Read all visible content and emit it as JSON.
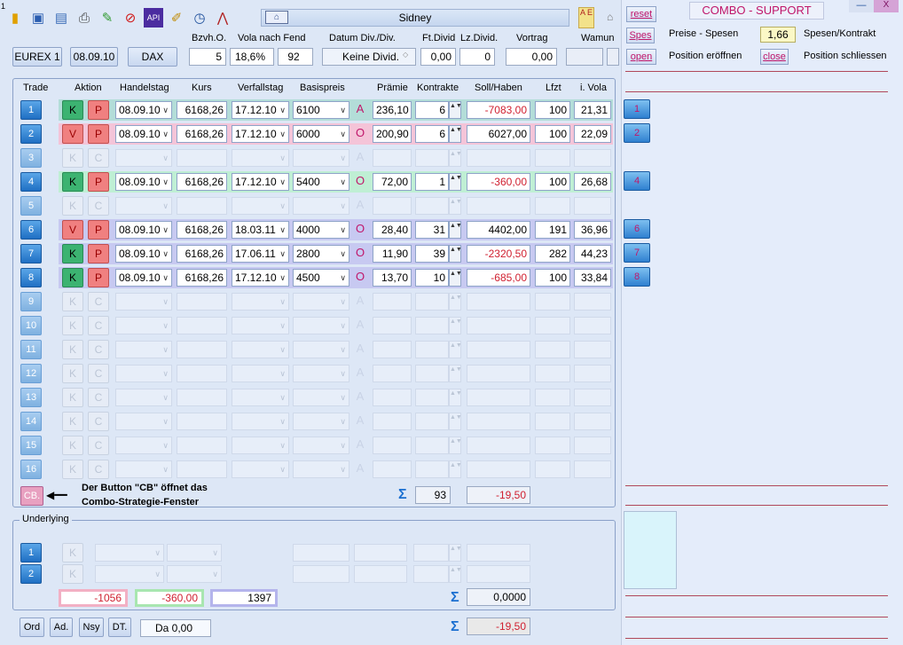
{
  "top_marker": "1",
  "toolbar": {
    "icons": [
      "notebook-icon",
      "save-icon",
      "document-icon",
      "printer-icon",
      "pencil-icon",
      "stop-icon",
      "api-icon",
      "edit-icon",
      "clock-icon",
      "chart-icon"
    ],
    "api_label": "API",
    "server": "Sidney",
    "ae_label": "A E"
  },
  "header_row": {
    "bzvh": "Bzvh.O.",
    "vola": "Vola nach Fend",
    "datum": "Datum Div./Div.",
    "ftdivid": "Ft.Divid",
    "lzdivid": "Lz.Divid.",
    "vortrag": "Vortrag",
    "wamun": "Wamun"
  },
  "market": {
    "exchange": "EUREX 1",
    "date": "08.09.10",
    "index": "DAX",
    "bzvh": "5",
    "vola": "18,6%",
    "vola_days": "92",
    "dividend": "Keine Divid.",
    "ftdivid": "0,00",
    "lzdivid": "0",
    "vortrag": "0,00"
  },
  "columns": {
    "trade": "Trade",
    "aktion": "Aktion",
    "handelstag": "Handelstag",
    "kurs": "Kurs",
    "verfallstag": "Verfallstag",
    "basispreis": "Basispreis",
    "praemie": "Prämie",
    "kontrakte": "Kontrakte",
    "sollhaben": "Soll/Haben",
    "lfzt": "Lfzt",
    "ivola": "i. Vola"
  },
  "rows": [
    {
      "n": "1",
      "a": "K",
      "b": "P",
      "handelstag": "08.09.10",
      "kurs": "6168,26",
      "verfall": "17.12.10",
      "basis": "6100",
      "ao": "A",
      "praemie": "236,10",
      "kontrakte": "6",
      "soll": "-7083,00",
      "lfzt": "100",
      "ivola": "21,31"
    },
    {
      "n": "2",
      "a": "V",
      "b": "P",
      "handelstag": "08.09.10",
      "kurs": "6168,26",
      "verfall": "17.12.10",
      "basis": "6000",
      "ao": "O",
      "praemie": "200,90",
      "kontrakte": "6",
      "soll": "6027,00",
      "lfzt": "100",
      "ivola": "22,09"
    },
    {
      "n": "3",
      "a": "K",
      "b": "C"
    },
    {
      "n": "4",
      "a": "K",
      "b": "P",
      "handelstag": "08.09.10",
      "kurs": "6168,26",
      "verfall": "17.12.10",
      "basis": "5400",
      "ao": "O",
      "praemie": "72,00",
      "kontrakte": "1",
      "soll": "-360,00",
      "lfzt": "100",
      "ivola": "26,68"
    },
    {
      "n": "5",
      "a": "K",
      "b": "C"
    },
    {
      "n": "6",
      "a": "V",
      "b": "P",
      "handelstag": "08.09.10",
      "kurs": "6168,26",
      "verfall": "18.03.11",
      "basis": "4000",
      "ao": "O",
      "praemie": "28,40",
      "kontrakte": "31",
      "soll": "4402,00",
      "lfzt": "191",
      "ivola": "36,96"
    },
    {
      "n": "7",
      "a": "K",
      "b": "P",
      "handelstag": "08.09.10",
      "kurs": "6168,26",
      "verfall": "17.06.11",
      "basis": "2800",
      "ao": "O",
      "praemie": "11,90",
      "kontrakte": "39",
      "soll": "-2320,50",
      "lfzt": "282",
      "ivola": "44,23"
    },
    {
      "n": "8",
      "a": "K",
      "b": "P",
      "handelstag": "08.09.10",
      "kurs": "6168,26",
      "verfall": "17.12.10",
      "basis": "4500",
      "ao": "O",
      "praemie": "13,70",
      "kontrakte": "10",
      "soll": "-685,00",
      "lfzt": "100",
      "ivola": "33,84"
    },
    {
      "n": "9",
      "a": "K",
      "b": "C"
    },
    {
      "n": "10",
      "a": "K",
      "b": "C"
    },
    {
      "n": "11",
      "a": "K",
      "b": "C"
    },
    {
      "n": "12",
      "a": "K",
      "b": "C"
    },
    {
      "n": "13",
      "a": "K",
      "b": "C"
    },
    {
      "n": "14",
      "a": "K",
      "b": "C"
    },
    {
      "n": "15",
      "a": "K",
      "b": "C"
    },
    {
      "n": "16",
      "a": "K",
      "b": "C"
    }
  ],
  "cb": {
    "label": "CB.",
    "note_line1": "Der Button \"CB\" öffnet das",
    "note_line2": "Combo-Strategie-Fenster"
  },
  "totals": {
    "kontrakte": "93",
    "soll": "-19,50"
  },
  "underlying": {
    "title": "Underlying",
    "rows": [
      {
        "n": "1",
        "a": "K"
      },
      {
        "n": "2",
        "a": "K"
      }
    ],
    "v1": "-1056",
    "v2": "-360,00",
    "v3": "1397",
    "total": "0,0000"
  },
  "bottom": {
    "ord": "Ord",
    "ad": "Ad.",
    "nsy": "Nsy",
    "dt": "DT.",
    "da": "Da  0,00",
    "total": "-19,50"
  },
  "side": {
    "title": "COMBO - SUPPORT",
    "reset": "reset",
    "spes": "Spes",
    "preise_label": "Preise - Spesen",
    "preise_value": "1,66",
    "spesen_label": "Spesen/Kontrakt",
    "open": "open",
    "open_label": "Position eröffnen",
    "close": "close",
    "close_label": "Position schliessen",
    "minimize": "—",
    "close_x": "X",
    "legs": [
      "1",
      "2",
      "4",
      "6",
      "7",
      "8"
    ]
  },
  "colors": {
    "accent_pink": "#c0166a",
    "green": "#3cb371",
    "pink": "#f08080"
  }
}
